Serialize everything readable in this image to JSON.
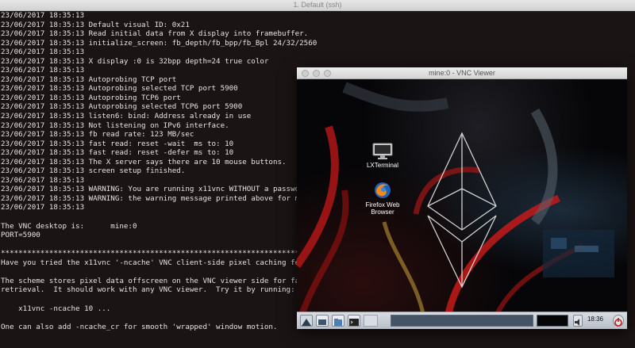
{
  "terminal": {
    "title": "1. Default (ssh)",
    "lines": [
      "23/06/2017 18:35:13",
      "23/06/2017 18:35:13 Default visual ID: 0x21",
      "23/06/2017 18:35:13 Read initial data from X display into framebuffer.",
      "23/06/2017 18:35:13 initialize_screen: fb_depth/fb_bpp/fb_Bpl 24/32/2560",
      "23/06/2017 18:35:13",
      "23/06/2017 18:35:13 X display :0 is 32bpp depth=24 true color",
      "23/06/2017 18:35:13",
      "23/06/2017 18:35:13 Autoprobing TCP port",
      "23/06/2017 18:35:13 Autoprobing selected TCP port 5900",
      "23/06/2017 18:35:13 Autoprobing TCP6 port",
      "23/06/2017 18:35:13 Autoprobing selected TCP6 port 5900",
      "23/06/2017 18:35:13 listen6: bind: Address already in use",
      "23/06/2017 18:35:13 Not listening on IPv6 interface.",
      "23/06/2017 18:35:13 fb read rate: 123 MB/sec",
      "23/06/2017 18:35:13 fast read: reset -wait  ms to: 10",
      "23/06/2017 18:35:13 fast read: reset -defer ms to: 10",
      "23/06/2017 18:35:13 The X server says there are 10 mouse buttons.",
      "23/06/2017 18:35:13 screen setup finished.",
      "23/06/2017 18:35:13",
      "23/06/2017 18:35:13 WARNING: You are running x11vnc WITHOUT a password.",
      "23/06/2017 18:35:13 WARNING: the warning message printed above for more",
      "23/06/2017 18:35:13",
      "",
      "The VNC desktop is:      mine:0",
      "PORT=5900",
      "",
      "******************************************************************************",
      "Have you tried the x11vnc '-ncache' VNC client-side pixel caching feature?",
      "",
      "The scheme stores pixel data offscreen on the VNC viewer side for faster",
      "retrieval.  It should work with any VNC viewer.  Try it by running:",
      "",
      "    x11vnc -ncache 10 ...",
      "",
      "One can also add -ncache_cr for smooth 'wrapped' window motion."
    ]
  },
  "vnc_viewer": {
    "title": "mine:0 - VNC Viewer",
    "desktop_icons": [
      {
        "label": "LXTerminal",
        "icon": "monitor-icon"
      },
      {
        "label_line1": "Firefox Web",
        "label_line2": "Browser",
        "icon": "firefox-icon"
      }
    ],
    "taskbar": {
      "clock": "18:36",
      "icons": [
        "menu-icon",
        "desktop-icon",
        "file-manager-icon",
        "terminal-icon",
        "volume-icon",
        "power-icon"
      ]
    }
  },
  "colors": {
    "terminal_bg": "#1b1414",
    "terminal_fg": "#e8e2e0",
    "accent_red": "#c41a1a"
  }
}
